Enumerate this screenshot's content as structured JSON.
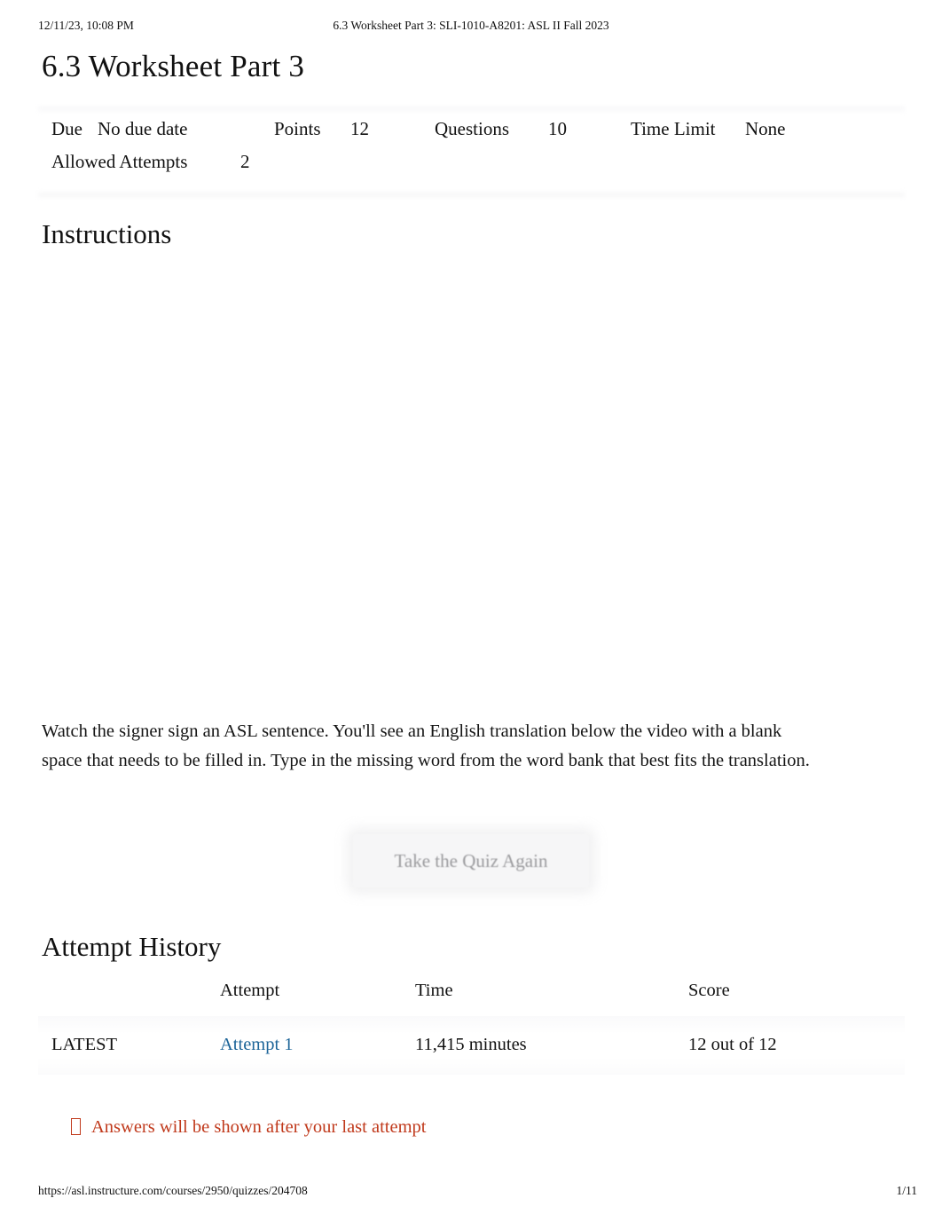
{
  "print_header": {
    "timestamp": "12/11/23, 10:08 PM",
    "document_title": "6.3 Worksheet Part 3: SLI-1010-A8201: ASL II Fall 2023"
  },
  "quiz": {
    "title": "6.3 Worksheet Part 3",
    "meta": {
      "due_label": "Due",
      "due_value": "No due date",
      "points_label": "Points",
      "points_value": "12",
      "questions_label": "Questions",
      "questions_value": "10",
      "time_limit_label": "Time Limit",
      "time_limit_value": "None",
      "allowed_attempts_label": "Allowed Attempts",
      "allowed_attempts_value": "2"
    }
  },
  "instructions": {
    "heading": "Instructions",
    "body": "Watch the signer sign an ASL sentence. You'll see an English translation below the video with a blank space that needs to be filled in. Type in the missing word from the word bank that best fits the translation."
  },
  "actions": {
    "retake_label": "Take the Quiz Again"
  },
  "attempt_history": {
    "heading": "Attempt History",
    "columns": [
      "",
      "Attempt",
      "Time",
      "Score"
    ],
    "rows": [
      {
        "kept": "LATEST",
        "attempt": "Attempt 1",
        "time": "11,415 minutes",
        "score": "12 out of 12"
      }
    ]
  },
  "notice": {
    "icon": "missing-glyph-box-icon",
    "text": "Answers will be shown after your last attempt",
    "color": "#c0391b"
  },
  "print_footer": {
    "url": "https://asl.instructure.com/courses/2950/quizzes/204708",
    "page": "1/11"
  },
  "colors": {
    "link": "#1c6498",
    "notice": "#c0391b",
    "text": "#111111",
    "muted_button_text": "#9a9a9d"
  }
}
